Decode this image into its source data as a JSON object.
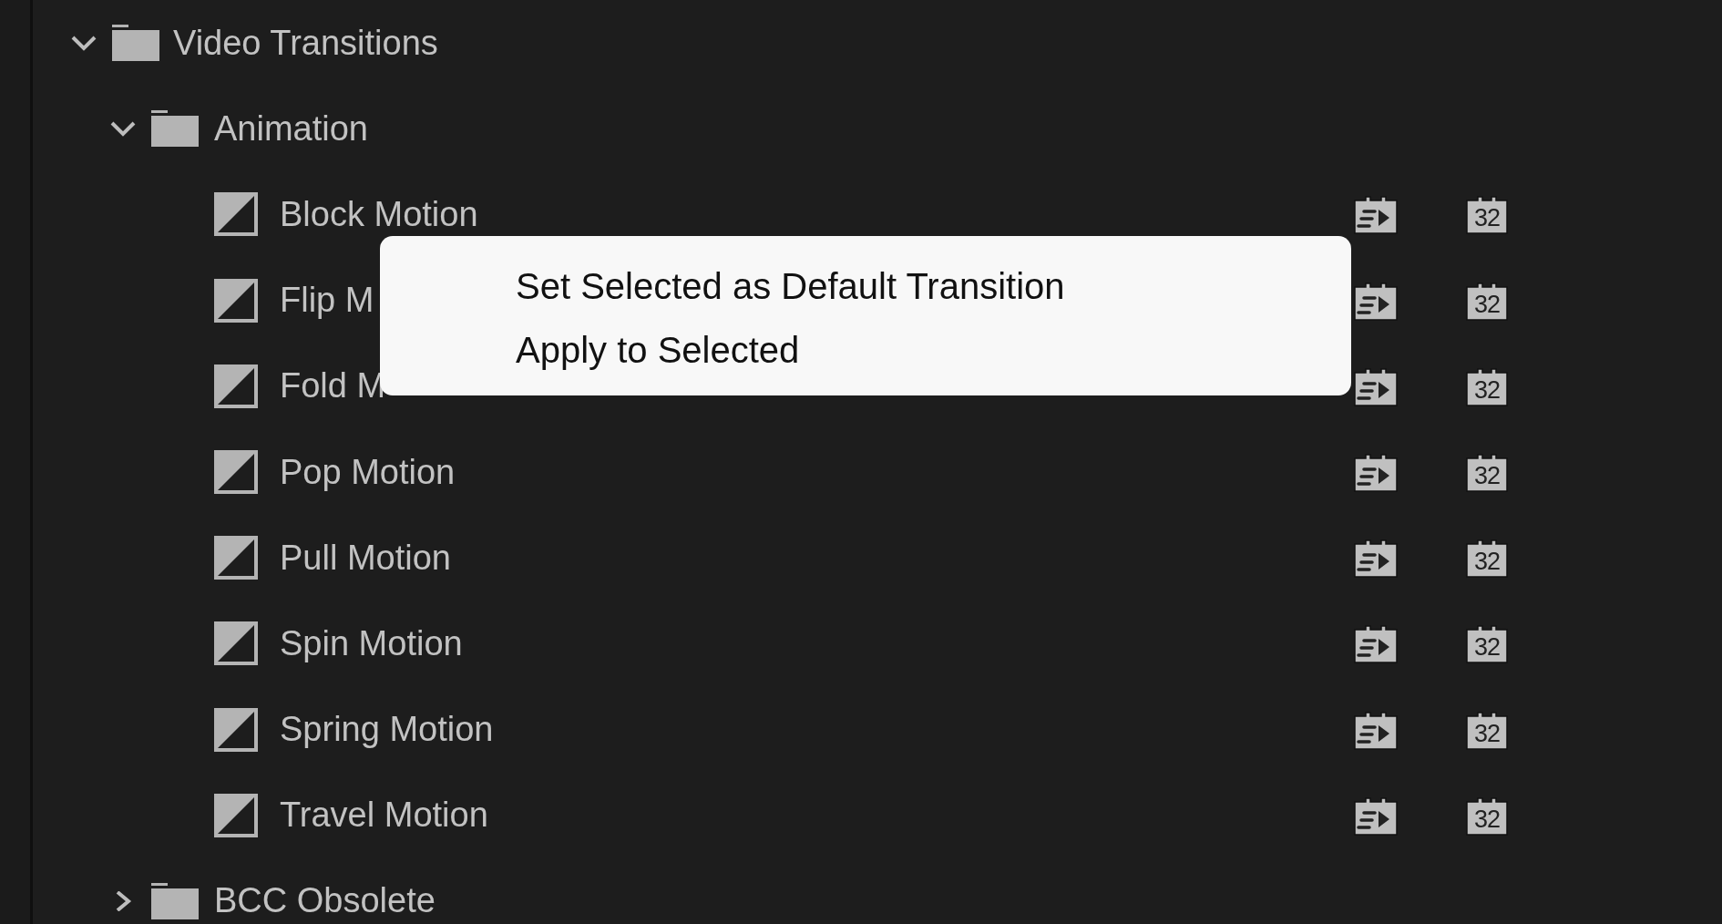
{
  "tree": [
    {
      "kind": "bin",
      "label": "Video Transitions",
      "expanded": true,
      "children": [
        {
          "kind": "bin",
          "label": "Animation",
          "expanded": true,
          "children": [
            {
              "kind": "transition",
              "label": "Block Motion",
              "badge": "32"
            },
            {
              "kind": "transition",
              "label": "Flip M",
              "badge": "32"
            },
            {
              "kind": "transition",
              "label": "Fold M",
              "badge": "32"
            },
            {
              "kind": "transition",
              "label": "Pop Motion",
              "badge": "32"
            },
            {
              "kind": "transition",
              "label": "Pull Motion",
              "badge": "32"
            },
            {
              "kind": "transition",
              "label": "Spin Motion",
              "badge": "32"
            },
            {
              "kind": "transition",
              "label": "Spring Motion",
              "badge": "32"
            },
            {
              "kind": "transition",
              "label": "Travel Motion",
              "badge": "32"
            }
          ]
        },
        {
          "kind": "bin",
          "label": "BCC Obsolete",
          "expanded": false
        }
      ]
    }
  ],
  "context_menu": {
    "items": [
      {
        "label": "Set Selected as Default Transition"
      },
      {
        "label": "Apply to Selected"
      }
    ]
  }
}
